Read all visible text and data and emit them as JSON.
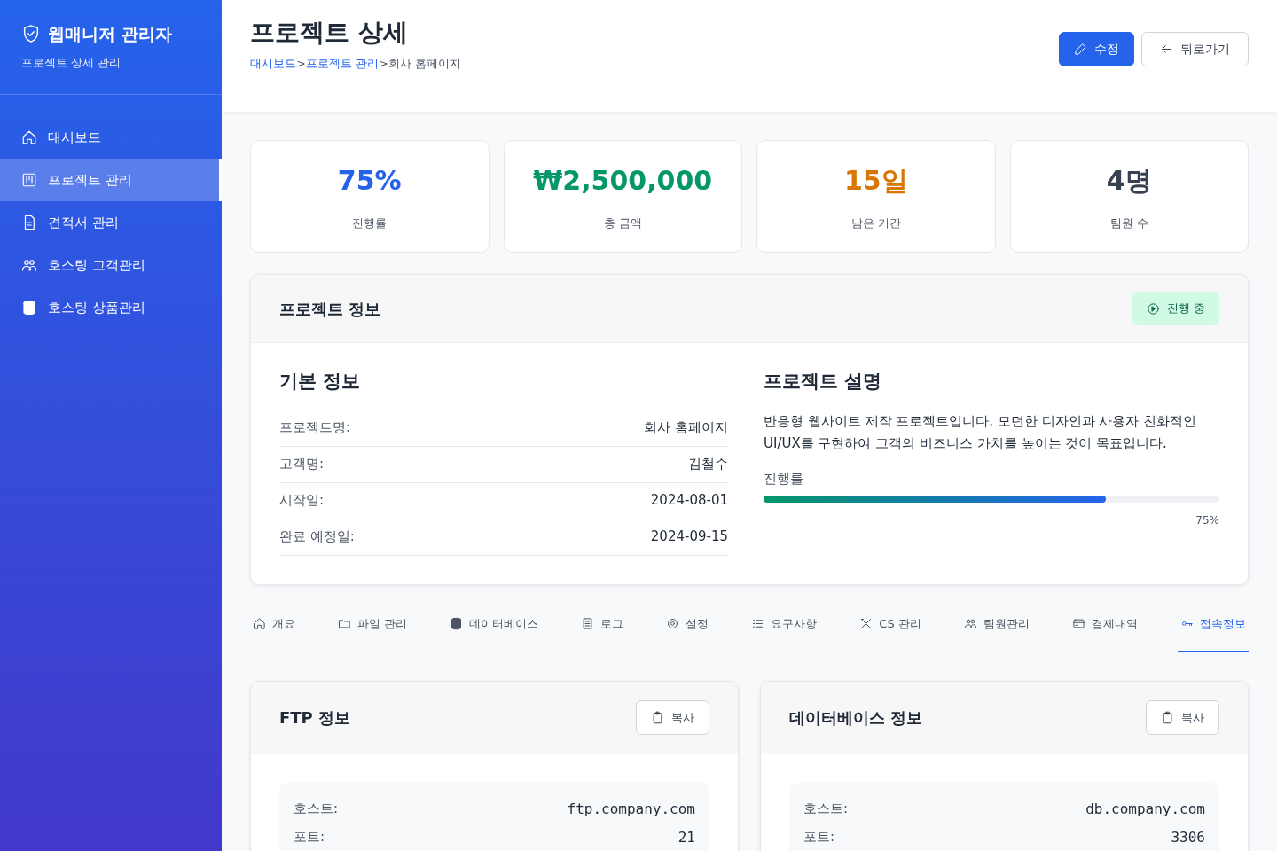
{
  "sidebar": {
    "title": "웹매니저 관리자",
    "subtitle": "프로젝트 상세 관리",
    "items": [
      {
        "label": "대시보드",
        "selected": false
      },
      {
        "label": "프로젝트 관리",
        "selected": true
      },
      {
        "label": "견적서 관리",
        "selected": false
      },
      {
        "label": "호스팅 고객관리",
        "selected": false
      },
      {
        "label": "호스팅 상품관리",
        "selected": false
      }
    ]
  },
  "header": {
    "title": "프로젝트 상세",
    "breadcrumb": [
      {
        "label": "대시보드",
        "link": true
      },
      {
        "label": ">",
        "link": false
      },
      {
        "label": "프로젝트 관리",
        "link": true
      },
      {
        "label": ">",
        "link": false
      },
      {
        "label": "회사 홈페이지",
        "link": false
      }
    ],
    "buttons": [
      {
        "label": "수정",
        "kind": "primary"
      },
      {
        "label": "뒤로가기",
        "kind": "outline"
      }
    ]
  },
  "stats": [
    {
      "value": "75%",
      "label": "진행률",
      "color": "#2563eb"
    },
    {
      "value": "₩2,500,000",
      "label": "총 금액",
      "color": "#059669"
    },
    {
      "value": "15일",
      "label": "남은 기간",
      "color": "#d97706"
    },
    {
      "value": "4명",
      "label": "팀원 수",
      "color": "#374151"
    }
  ],
  "project": {
    "title": "프로젝트 정보",
    "status": "진행 중",
    "basic": {
      "title": "기본 정보",
      "rows": [
        {
          "label": "프로젝트명:",
          "value": "회사 홈페이지"
        },
        {
          "label": "고객명:",
          "value": "김철수"
        },
        {
          "label": "시작일:",
          "value": "2024-08-01"
        },
        {
          "label": "완료 예정일:",
          "value": "2024-09-15"
        }
      ]
    },
    "description": {
      "title": "프로젝트 설명",
      "text": "반응형 웹사이트 제작 프로젝트입니다. 모던한 디자인과 사용자 친화적인 UI/UX를 구현하여 고객의 비즈니스 가치를 높이는 것이 목표입니다.",
      "progress_label": "진행률",
      "level": 0.75,
      "reading": "75%"
    }
  },
  "tabs": [
    {
      "label": "개요",
      "selected": false
    },
    {
      "label": "파일 관리",
      "selected": false
    },
    {
      "label": "데이터베이스",
      "selected": false
    },
    {
      "label": "로그",
      "selected": false
    },
    {
      "label": "설정",
      "selected": false
    },
    {
      "label": "요구사항",
      "selected": false
    },
    {
      "label": "CS 관리",
      "selected": false
    },
    {
      "label": "팀원관리",
      "selected": false
    },
    {
      "label": "결제내역",
      "selected": false
    },
    {
      "label": "접속정보",
      "selected": true
    }
  ],
  "access_cards": [
    {
      "title": "FTP 정보",
      "copy_button": "복사",
      "rows": [
        {
          "label": "호스트:",
          "value": "ftp.company.com"
        },
        {
          "label": "포트:",
          "value": "21"
        }
      ]
    },
    {
      "title": "데이터베이스 정보",
      "copy_button": "복사",
      "rows": [
        {
          "label": "호스트:",
          "value": "db.company.com"
        },
        {
          "label": "포트:",
          "value": "3306"
        }
      ]
    }
  ]
}
